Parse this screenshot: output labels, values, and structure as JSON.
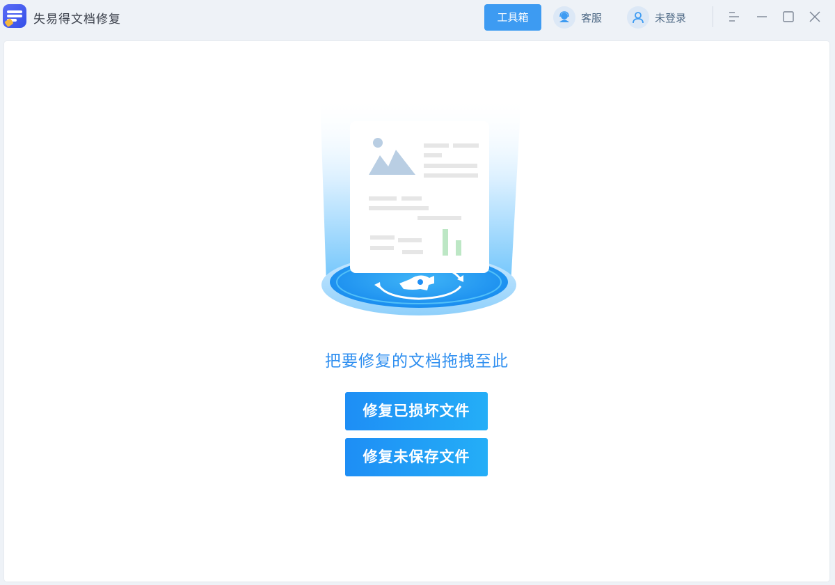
{
  "app": {
    "title": "失易得文档修复",
    "logo_icon": "app-logo-icon"
  },
  "header": {
    "toolbox_label": "工具箱",
    "service_label": "客服",
    "login_label": "未登录",
    "accent_color": "#3d9bf2"
  },
  "window_controls": {
    "menu_icon": "menu-icon",
    "minimize_icon": "minimize-icon",
    "maximize_icon": "maximize-icon",
    "close_icon": "close-icon"
  },
  "main": {
    "drop_hint": "把要修复的文档拖拽至此",
    "buttons": {
      "repair_damaged": "修复已损坏文件",
      "repair_unsaved": "修复未保存文件"
    },
    "illustration_icon": "document-repair-illustration"
  }
}
